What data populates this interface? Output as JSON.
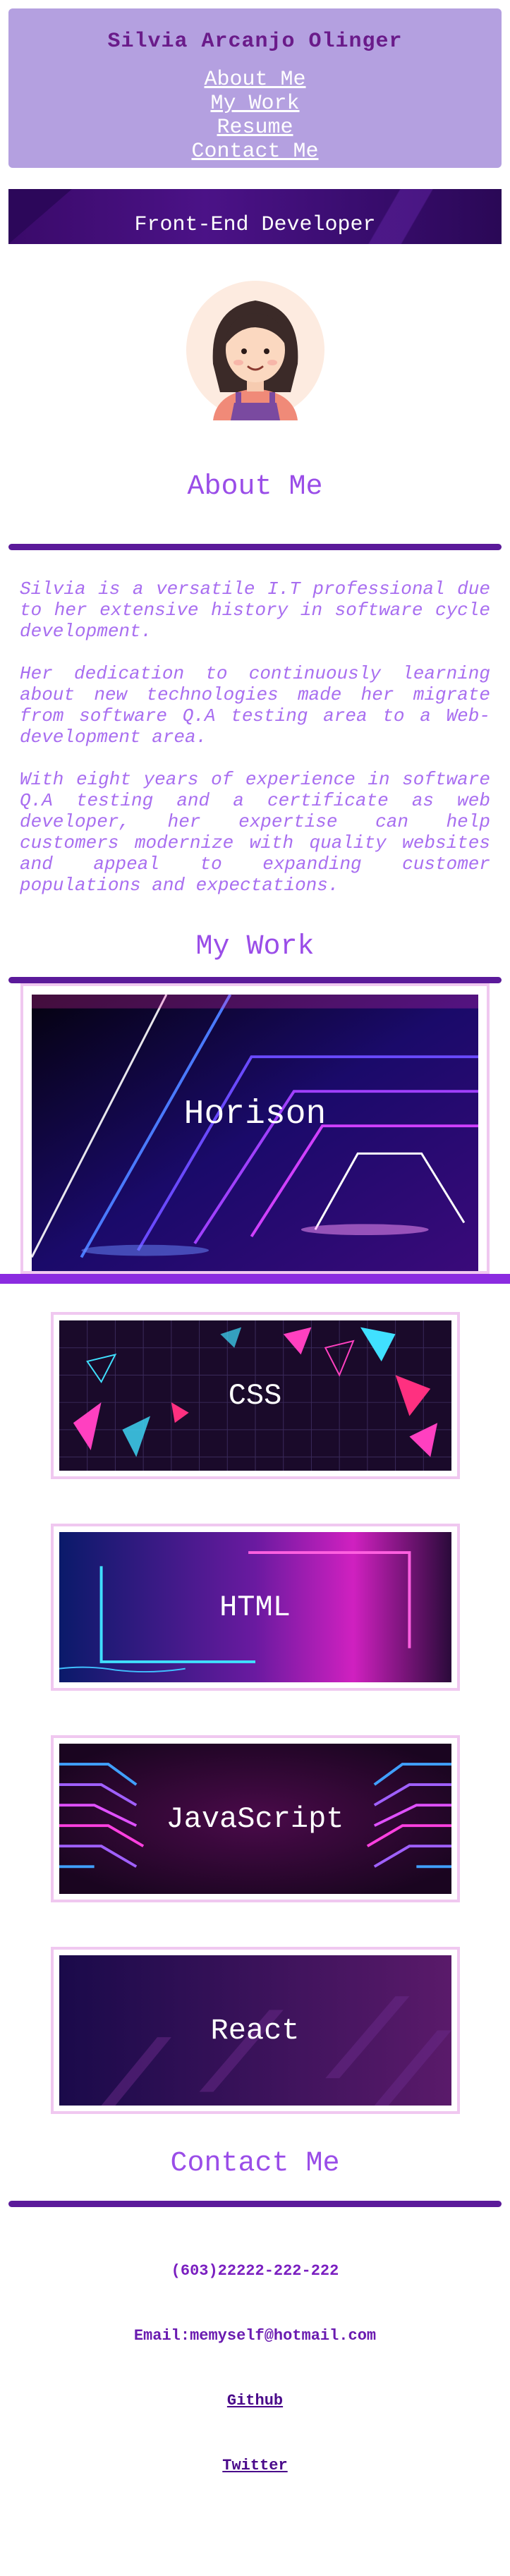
{
  "header": {
    "title": "Silvia Arcanjo Olinger",
    "nav": [
      "About Me",
      "My Work",
      "Resume",
      "Contact Me"
    ]
  },
  "banner": {
    "title": "Front-End Developer"
  },
  "about": {
    "title": "About Me",
    "paragraphs": [
      "Silvia is a versatile I.T professional due to her extensive history in software cycle development.",
      "Her dedication to continuously learning about new technologies made her migrate from software Q.A testing area to a Web-development area.",
      "With eight years of experience in software Q.A testing and a certificate as web developer, her expertise can help customers modernize with quality websites and appeal to expanding customer populations and expectations."
    ]
  },
  "work": {
    "title": "My Work",
    "projects": [
      "Horison",
      "CSS",
      "HTML",
      "JavaScript",
      "React"
    ]
  },
  "contact": {
    "title": "Contact Me",
    "phone": "(603)22222-222-222",
    "email": "Email:memyself@hotmail.com",
    "github": "Github",
    "twitter": "Twitter"
  },
  "colors": {
    "header_bg": "#b4a0e0",
    "accent": "#8a3ffc",
    "rule": "#5b1a9a",
    "title": "#6a1b8a"
  }
}
